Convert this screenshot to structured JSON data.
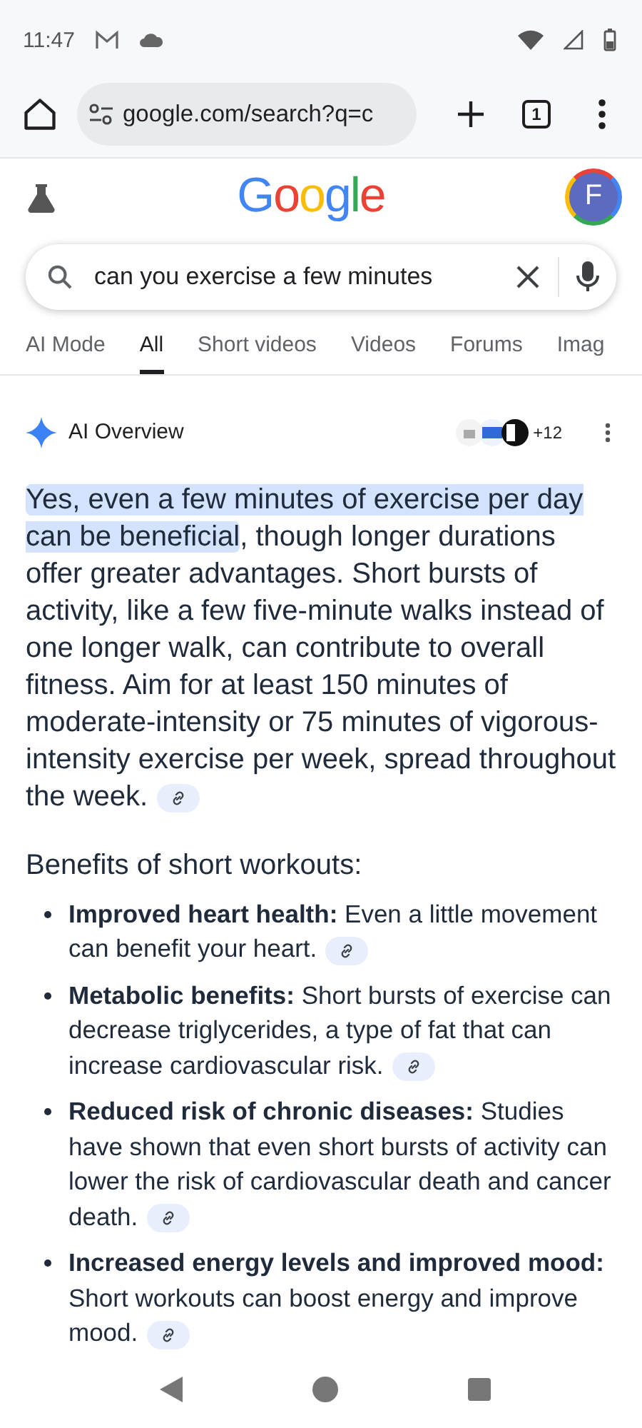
{
  "status_bar": {
    "time": "11:47"
  },
  "browser": {
    "url": "google.com/search?q=c",
    "tab_count": "1"
  },
  "header": {
    "logo": "Google",
    "avatar": "F"
  },
  "search": {
    "value": "can you exercise a few minutes"
  },
  "tabs": [
    {
      "label": "AI Mode",
      "selected": false
    },
    {
      "label": "All",
      "selected": true
    },
    {
      "label": "Short videos",
      "selected": false
    },
    {
      "label": "Videos",
      "selected": false
    },
    {
      "label": "Forums",
      "selected": false
    },
    {
      "label": "Imag",
      "selected": false
    }
  ],
  "overview": {
    "title": "AI Overview",
    "source_count": "+12",
    "highlight": "Yes, even a few minutes of exercise per day can be beneficial",
    "text": ", though longer durations offer greater advantages. Short bursts of activity, like a few five-minute walks instead of one longer walk, can contribute to overall fitness. Aim for at least 150 minutes of moderate-intensity or 75 minutes of vigorous-intensity exercise per week, spread throughout the week.",
    "heading": "Benefits of short workouts:",
    "bullets": [
      "**Improved heart health:** Even a little movement can benefit your heart.",
      "**Metabolic benefits:** Short bursts of exercise can decrease triglycerides, a type of fat that can increase cardiovascular risk.",
      "**Reduced risk of chronic diseases:** Studies have shown that even short bursts of activity can lower the risk of cardiovascular death and cancer death.",
      "**Increased energy levels and improved mood:** Short workouts can boost energy and improve mood."
    ]
  }
}
